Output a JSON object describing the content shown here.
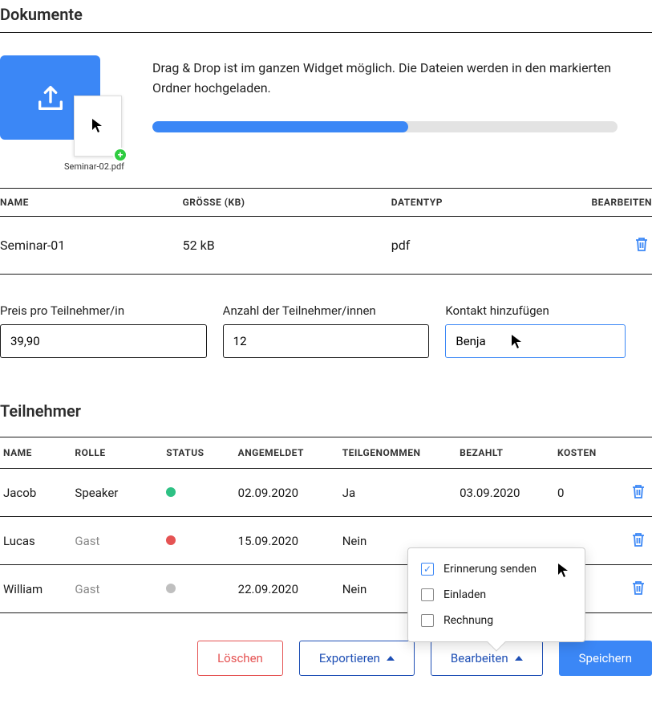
{
  "documents": {
    "title": "Dokumente",
    "hint": "Drag & Drop ist im ganzen Widget möglich. Die Dateien werden in den markierten Ordner hochgeladen.",
    "uploading_file": "Seminar-02.pdf",
    "progress_percent": 55,
    "columns": {
      "name": "NAME",
      "size": "GRÖSSE (KB)",
      "type": "DATENTYP",
      "edit": "BEARBEITEN"
    },
    "rows": [
      {
        "name": "Seminar-01",
        "size": "52 kB",
        "type": "pdf"
      }
    ]
  },
  "fields": {
    "price": {
      "label": "Preis pro Teilnehmer/in",
      "value": "39,90"
    },
    "count": {
      "label": "Anzahl der Teilnehmer/innen",
      "value": "12"
    },
    "contact": {
      "label": "Kontakt hinzufügen",
      "value": "Benja"
    }
  },
  "participants": {
    "title": "Teilnehmer",
    "columns": {
      "name": "NAME",
      "role": "ROLLE",
      "status": "STATUS",
      "registered": "ANGEMELDET",
      "attended": "TEILGENOMMEN",
      "paid": "BEZAHLT",
      "cost": "KOSTEN"
    },
    "rows": [
      {
        "name": "Jacob",
        "role": "Speaker",
        "status_color": "#2ec184",
        "registered": "02.09.2020",
        "attended": "Ja",
        "paid": "03.09.2020",
        "cost": "0"
      },
      {
        "name": "Lucas",
        "role": "Gast",
        "status_color": "#e55353",
        "registered": "15.09.2020",
        "attended": "Nein",
        "paid": "",
        "cost": ""
      },
      {
        "name": "William",
        "role": "Gast",
        "status_color": "#bfbfbf",
        "registered": "22.09.2020",
        "attended": "Nein",
        "paid": "",
        "cost": ""
      }
    ]
  },
  "context_menu": {
    "items": [
      {
        "label": "Erinnerung senden",
        "checked": true
      },
      {
        "label": "Einladen",
        "checked": false
      },
      {
        "label": "Rechnung",
        "checked": false
      }
    ]
  },
  "buttons": {
    "delete": "Löschen",
    "export": "Exportieren",
    "edit": "Bearbeiten",
    "save": "Speichern"
  }
}
